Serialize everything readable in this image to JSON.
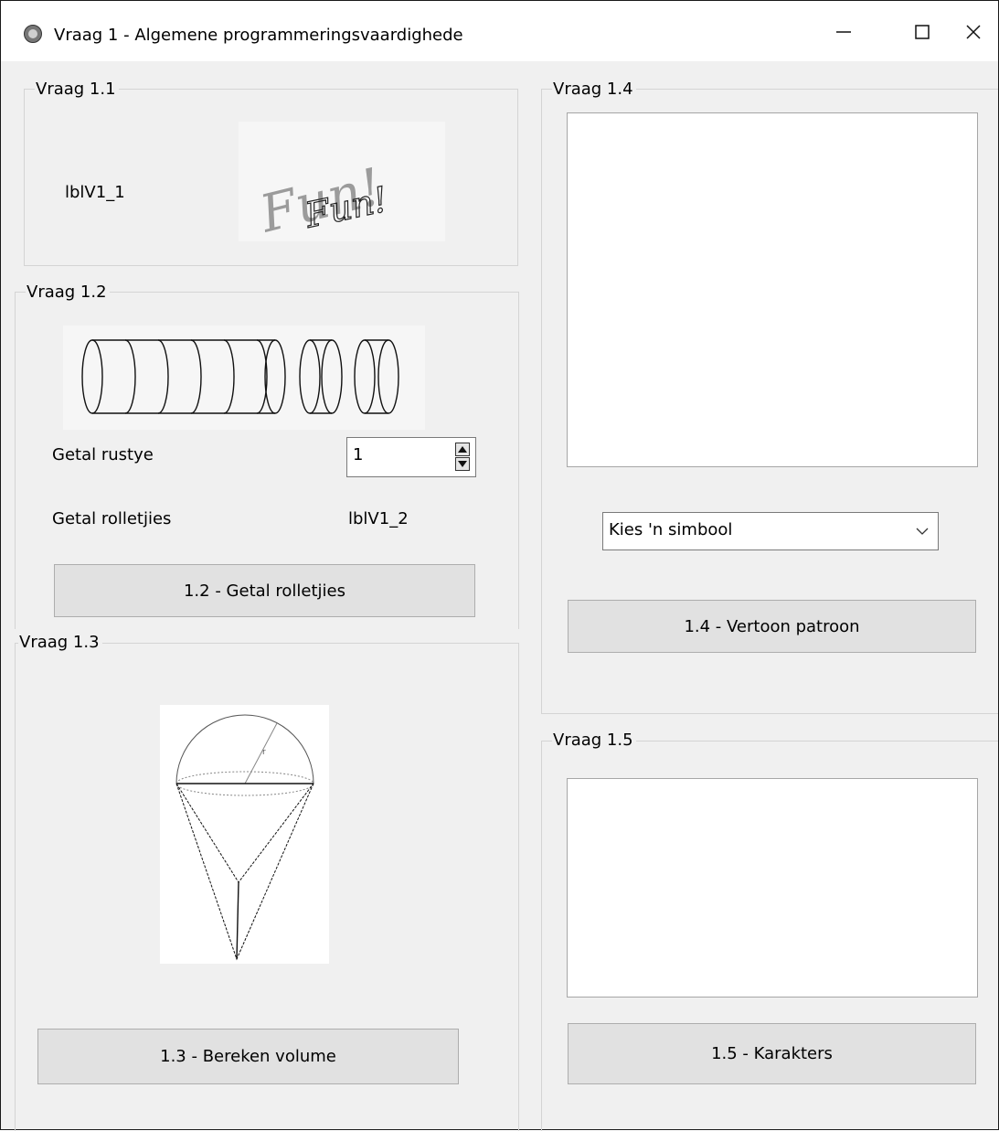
{
  "window": {
    "title": "Vraag 1 - Algemene programmeringsvaardighede",
    "minimize_glyph": "—",
    "maximize_glyph": "☐",
    "close_glyph": "✕",
    "icon": "app-icon"
  },
  "q1_1": {
    "legend": "Vraag 1.1",
    "label": "lblV1_1",
    "image_text_back": "Fun!",
    "image_text_front": "Fun!"
  },
  "q1_2": {
    "legend": "Vraag 1.2",
    "rests_label": "Getal rustye",
    "rests_value": "1",
    "rolls_label": "Getal rolletjies",
    "rolls_value": "lblV1_2",
    "button": "1.2 - Getal rolletjies"
  },
  "q1_3": {
    "legend": "Vraag 1.3",
    "button": "1.3 - Bereken volume"
  },
  "q1_4": {
    "legend": "Vraag 1.4",
    "combo_value": "Kies 'n simbool",
    "button": "1.4 - Vertoon patroon"
  },
  "q1_5": {
    "legend": "Vraag 1.5",
    "button": "1.5 - Karakters"
  }
}
